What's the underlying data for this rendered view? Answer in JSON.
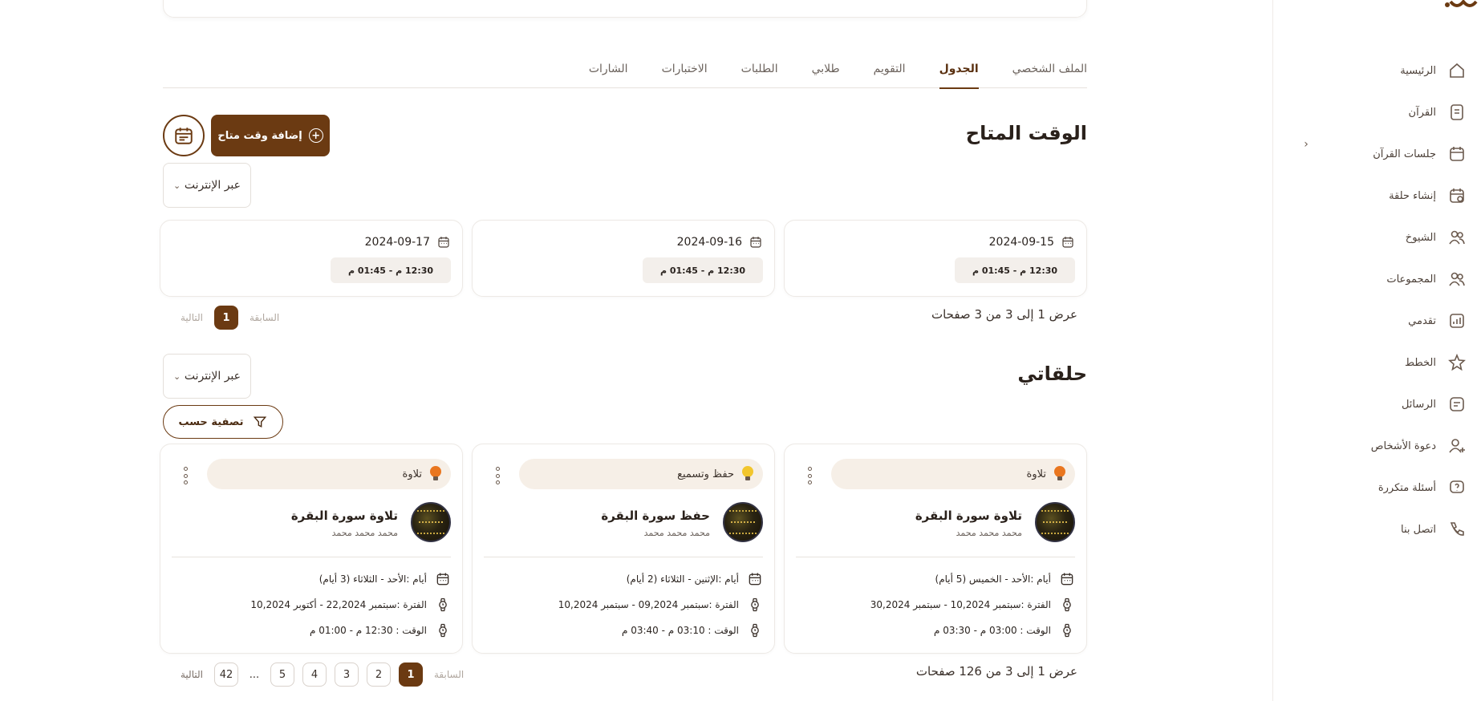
{
  "sidebar": {
    "items": [
      {
        "label": "الرئيسية",
        "icon": "home-icon"
      },
      {
        "label": "القرآن",
        "icon": "book-icon"
      },
      {
        "label": "جلسات القرآن",
        "icon": "calendar-icon"
      },
      {
        "label": "إنشاء حلقة",
        "icon": "calendar-plus-icon"
      },
      {
        "label": "الشيوخ",
        "icon": "users-icon"
      },
      {
        "label": "المجموعات",
        "icon": "group-icon"
      },
      {
        "label": "تقدمي",
        "icon": "chart-icon"
      },
      {
        "label": "الخطط",
        "icon": "star-icon"
      },
      {
        "label": "الرسائل",
        "icon": "message-icon"
      },
      {
        "label": "دعوة الأشخاص",
        "icon": "user-add-icon"
      },
      {
        "label": "أسئلة متكررة",
        "icon": "question-icon"
      },
      {
        "label": "اتصل بنا",
        "icon": "phone-icon"
      }
    ],
    "collapse": "‹"
  },
  "tabs": [
    {
      "label": "الملف الشخصي",
      "active": false
    },
    {
      "label": "الجدول",
      "active": true
    },
    {
      "label": "التقويم",
      "active": false
    },
    {
      "label": "طلابي",
      "active": false
    },
    {
      "label": "الطلبات",
      "active": false
    },
    {
      "label": "الاختبارات",
      "active": false
    },
    {
      "label": "الشارات",
      "active": false
    }
  ],
  "available": {
    "title": "الوقت المتاح",
    "add_label": "إضافة وقت متاح",
    "filter_value": "عبر الإنترنت",
    "slots": [
      {
        "date": "2024-09-15",
        "time": "12:30 م - 01:45 م"
      },
      {
        "date": "2024-09-16",
        "time": "12:30 م - 01:45 م"
      },
      {
        "date": "2024-09-17",
        "time": "12:30 م - 01:45 م"
      }
    ],
    "summary": "عرض 1 إلى 3 من 3 صفحات",
    "pager": {
      "prev": "السابقة",
      "next": "التالية",
      "pages": [
        "1"
      ],
      "current": "1"
    }
  },
  "halaqat": {
    "title": "حلقاتي",
    "filter_value": "عبر الإنترنت",
    "filter_by": "تصفية حسب",
    "cards": [
      {
        "type": "تلاوة",
        "bulb": "#e9761f",
        "title": "تلاوة سورة البقرة",
        "teacher": "محمد محمد محمد",
        "days": "أيام :الأحد - الخميس (5 أيام)",
        "period": "الفترة :سبتمبر 10,2024 - سبتمبر 30,2024",
        "time": "الوقت : 03:00 م - 03:30 م"
      },
      {
        "type": "حفظ وتسميع",
        "bulb": "#f2c62e",
        "title": "حفظ سورة البقرة",
        "teacher": "محمد محمد محمد",
        "days": "أيام :الإثنين - الثلاثاء (2 أيام)",
        "period": "الفترة :سبتمبر 09,2024 - سبتمبر 10,2024",
        "time": "الوقت : 03:10 م - 03:40 م"
      },
      {
        "type": "تلاوة",
        "bulb": "#e9761f",
        "title": "تلاوة سورة البقرة",
        "teacher": "محمد محمد محمد",
        "days": "أيام :الأحد - الثلاثاء (3 أيام)",
        "period": "الفترة :سبتمبر 22,2024 - أكتوبر 10,2024",
        "time": "الوقت : 12:30 م - 01:00 م"
      }
    ],
    "summary": "عرض 1 إلى 3 من 126 صفحات",
    "pager": {
      "prev": "السابقة",
      "next": "التالية",
      "pages": [
        "1",
        "2",
        "3",
        "4",
        "5"
      ],
      "ellipsis": "...",
      "last": "42",
      "current": "1"
    }
  },
  "colors": {
    "accent": "#6b3a12",
    "pill_bg": "#f6efe7",
    "time_bg": "#f3efeb"
  }
}
